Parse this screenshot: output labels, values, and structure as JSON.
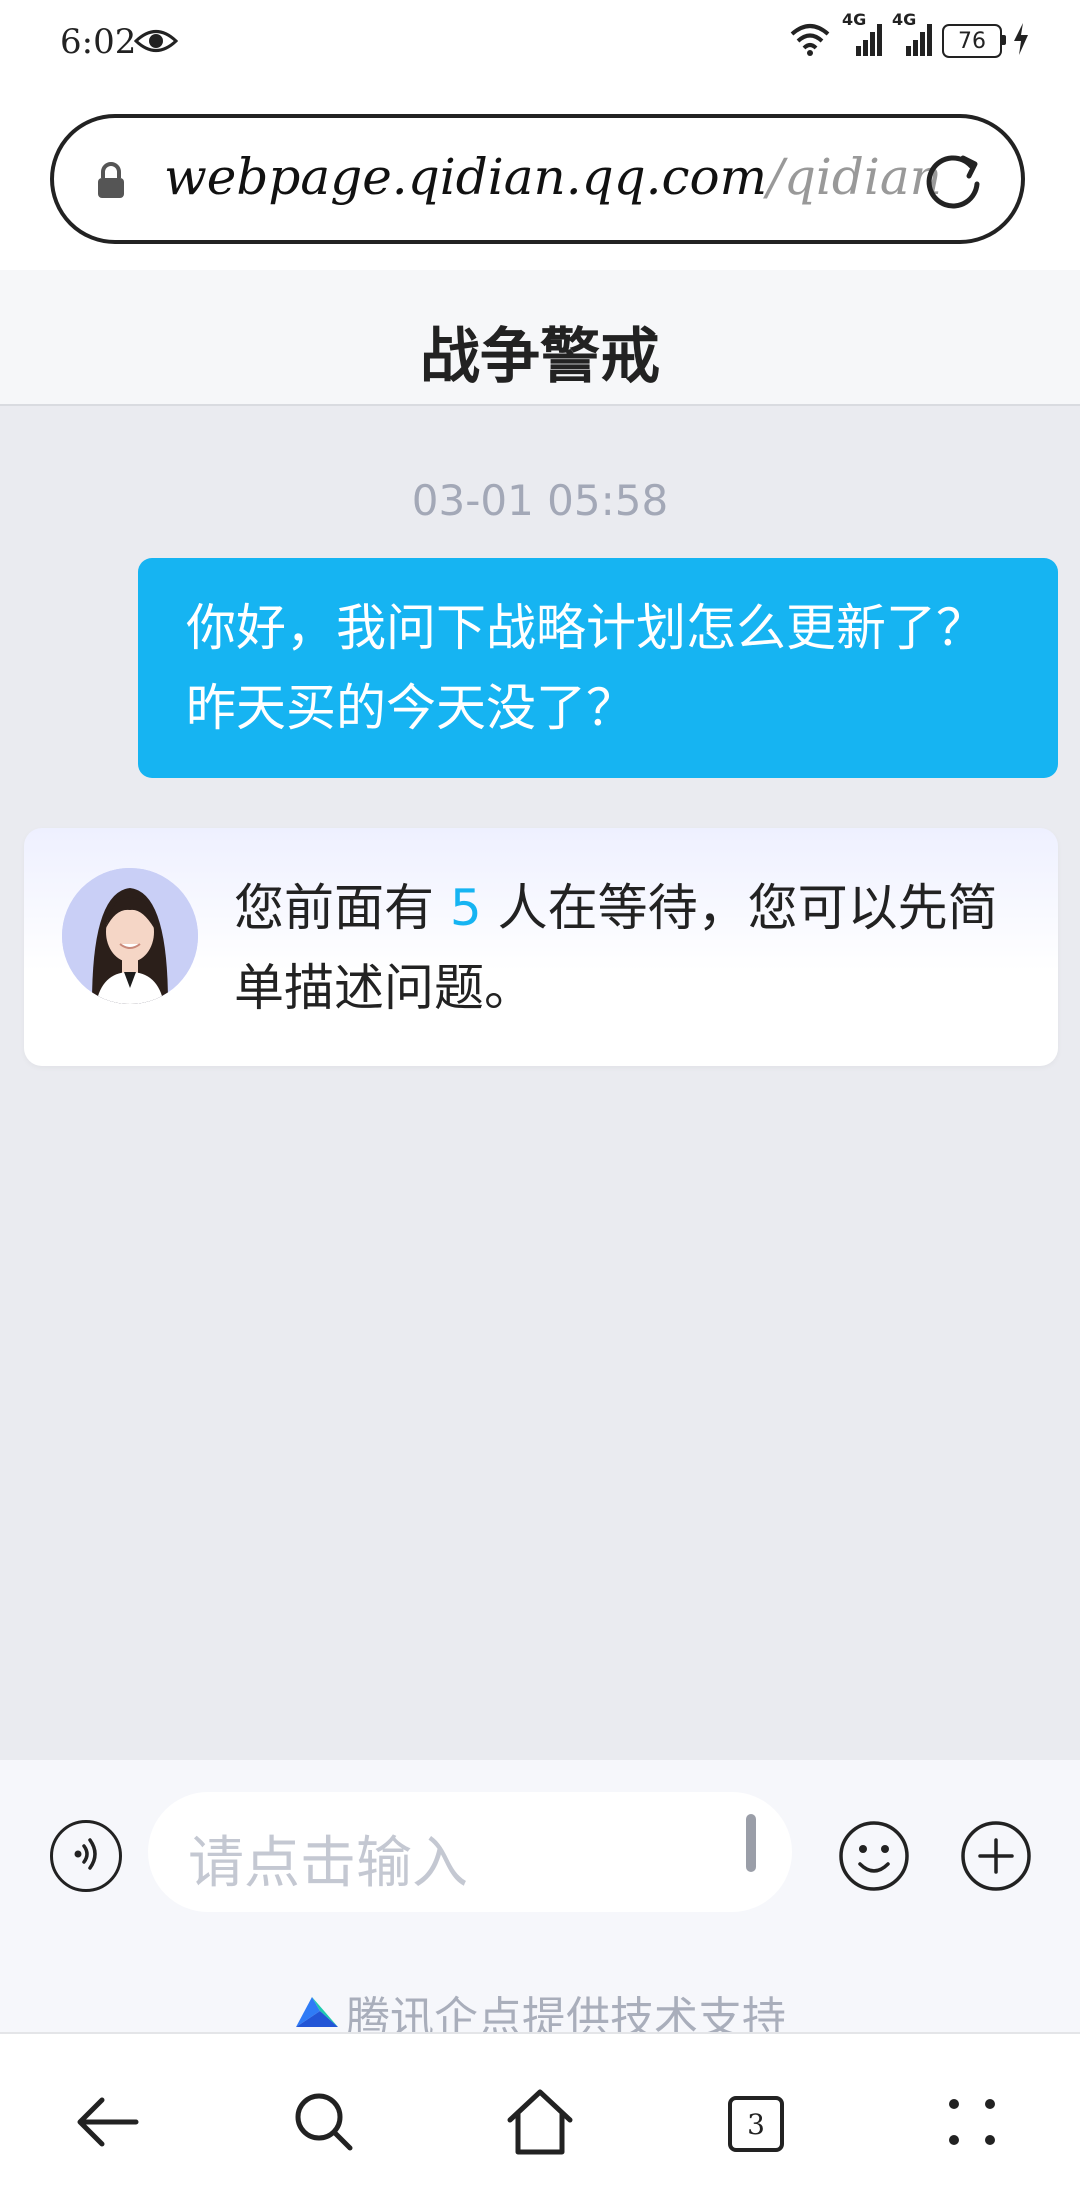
{
  "status_bar": {
    "time": "6:02",
    "network_1": "4G",
    "network_2": "4G",
    "battery": "76",
    "icons": [
      "eye-icon",
      "wifi-icon",
      "signal-icon",
      "signal-icon",
      "battery-icon",
      "charging-icon"
    ]
  },
  "browser": {
    "url_main": "webpage.qidian.qq.com",
    "url_path": "/qidian",
    "icons": [
      "lock-icon",
      "reload-icon"
    ]
  },
  "chat": {
    "title": "战争警戒",
    "timestamp": "03-01 05:58",
    "user_message": "你好，我问下战略计划怎么更新了？昨天买的今天没了？",
    "agent_message_before": "您前面有",
    "agent_queue_count": "5",
    "agent_message_after": "人在等待，您可以先简单描述问题。"
  },
  "input": {
    "placeholder": "请点击输入",
    "powered_by": "腾讯企点提供技术支持",
    "icons": [
      "voice-icon",
      "emoji-icon",
      "plus-icon",
      "qidian-logo-icon"
    ]
  },
  "nav": {
    "tabs_count": "3",
    "icons": [
      "back-icon",
      "search-icon",
      "home-icon",
      "tabs-icon",
      "menu-icon"
    ]
  },
  "colors": {
    "accent": "#16b4f2",
    "chat_bg": "#eaebf0",
    "muted_text": "#a3a8b7"
  }
}
